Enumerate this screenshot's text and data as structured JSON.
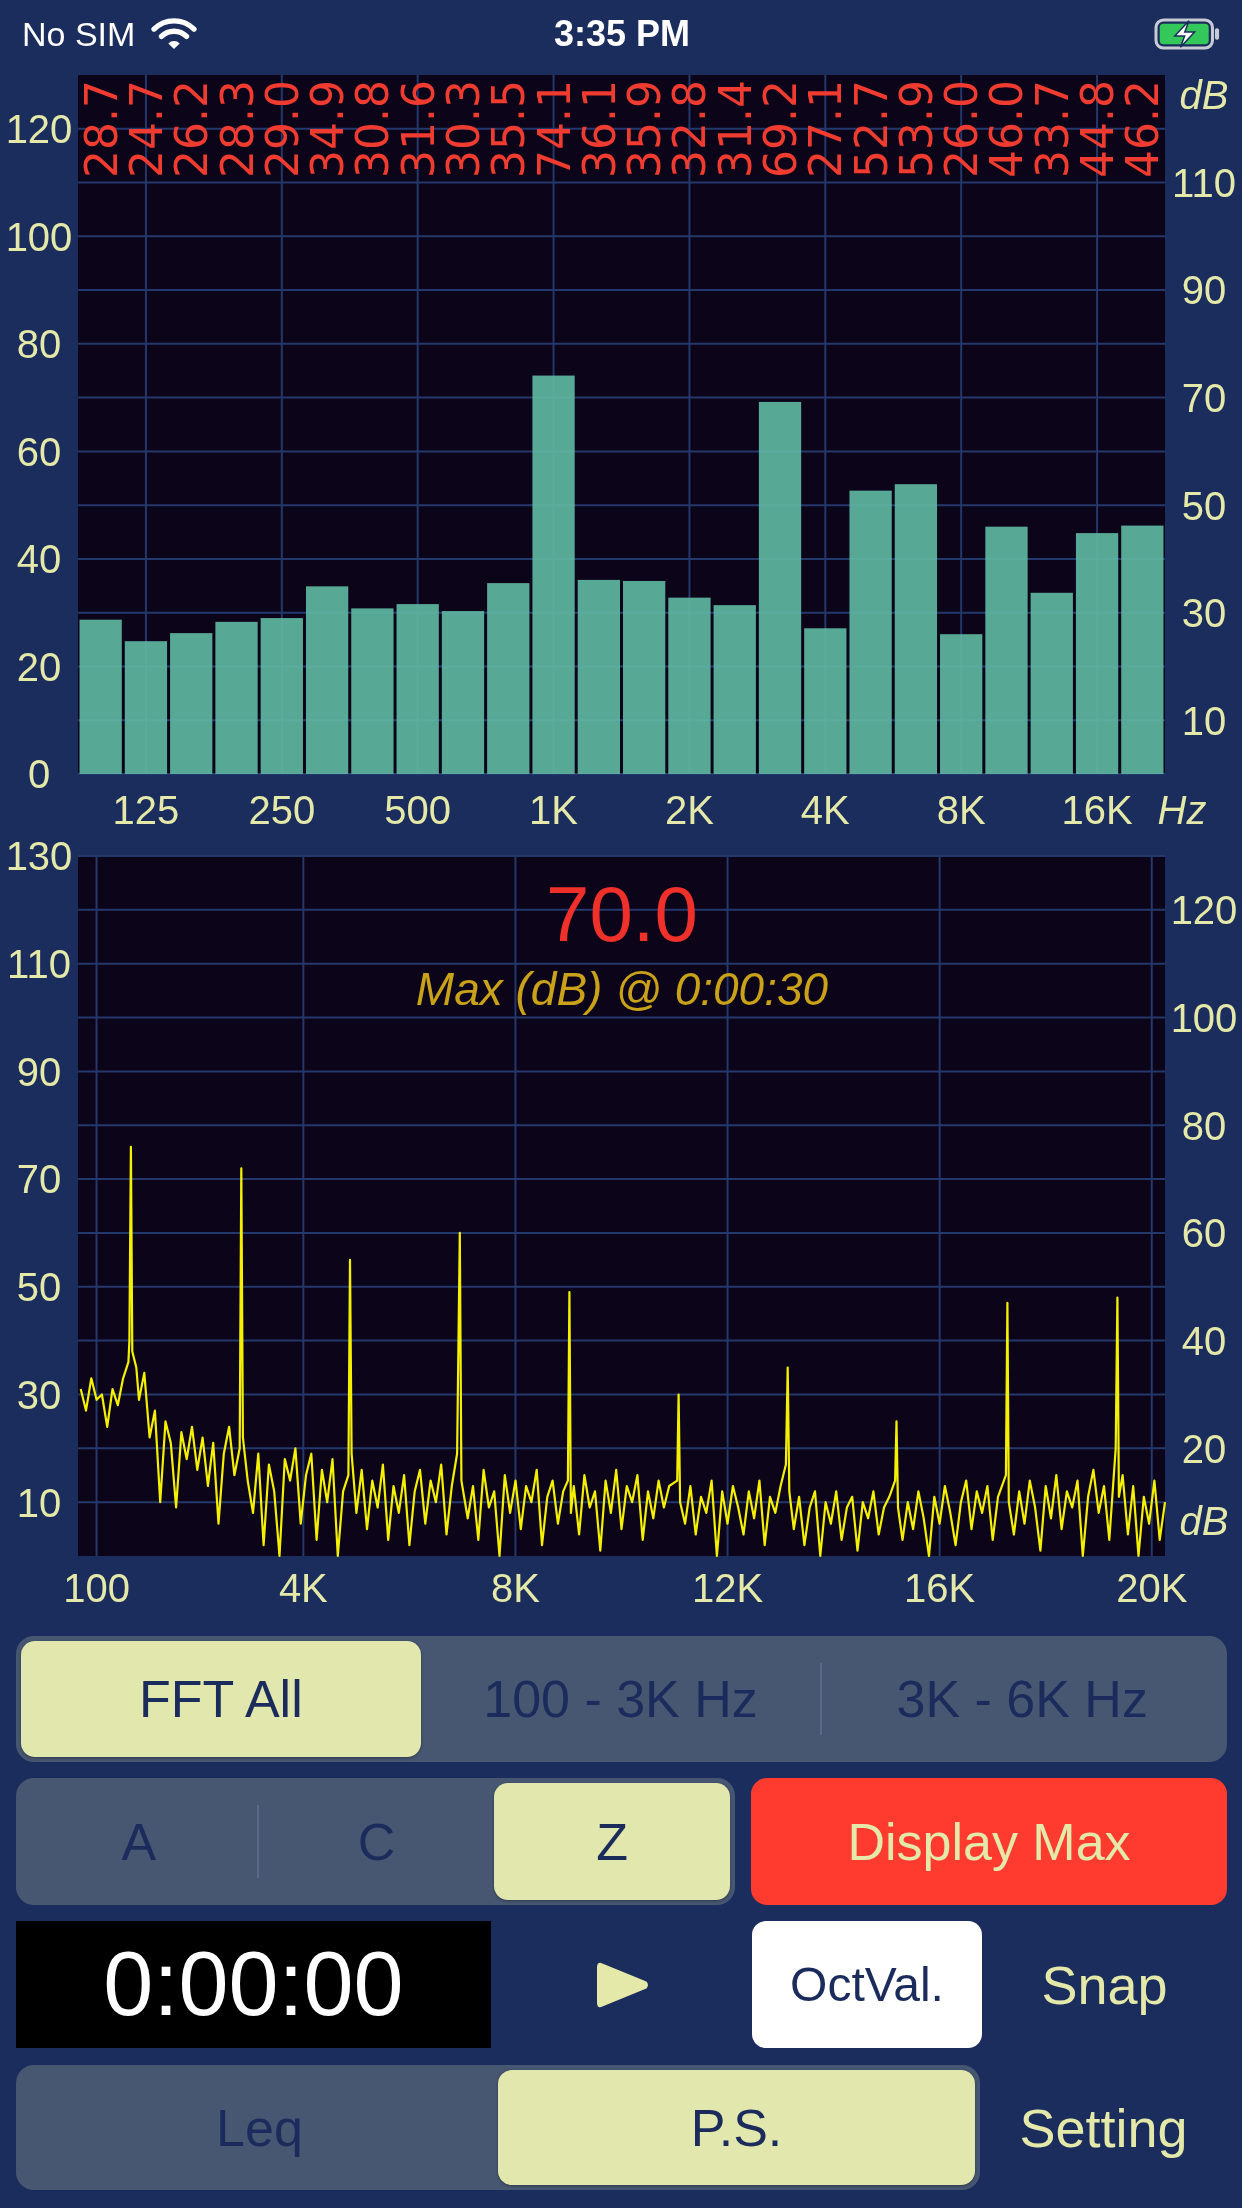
{
  "status_bar": {
    "carrier": "No SIM",
    "time": "3:35 PM"
  },
  "octave_chart": {
    "band_readings": [
      "28.7",
      "24.7",
      "26.2",
      "28.3",
      "29.0",
      "34.9",
      "30.8",
      "31.6",
      "30.3",
      "35.5",
      "74.1",
      "36.1",
      "35.9",
      "32.8",
      "31.4",
      "69.2",
      "27.1",
      "52.7",
      "53.9",
      "26.0",
      "46.0",
      "33.7",
      "44.8",
      "46.2"
    ],
    "right_axis_labels": [
      "110",
      "90",
      "70",
      "50",
      "30",
      "10"
    ],
    "chart_data": {
      "type": "bar",
      "xlabel": "Hz",
      "ylabel": "dB",
      "categories": [
        null,
        "125",
        null,
        null,
        "250",
        null,
        null,
        "500",
        null,
        null,
        "1K",
        null,
        null,
        "2K",
        null,
        null,
        "4K",
        null,
        null,
        "8K",
        null,
        null,
        "16K",
        null
      ],
      "values": [
        28.7,
        24.7,
        26.2,
        28.3,
        29.0,
        34.9,
        30.8,
        31.6,
        30.3,
        35.5,
        74.1,
        36.1,
        35.9,
        32.8,
        31.4,
        69.2,
        27.1,
        52.7,
        53.9,
        26.0,
        46.0,
        33.7,
        44.8,
        46.2
      ],
      "ylim": [
        0,
        130
      ],
      "yticks": [
        0,
        20,
        40,
        60,
        80,
        100,
        120
      ],
      "grid": true
    }
  },
  "spectrum_chart": {
    "max_value": "70.0",
    "max_caption": "Max (dB) @ 0:00:30",
    "right_axis_labels": [
      "120",
      "100",
      "80",
      "60",
      "40",
      "20"
    ],
    "chart_data": {
      "type": "line",
      "ylabel": "dB",
      "x": [
        -200,
        -100,
        0,
        100,
        200,
        300,
        400,
        500,
        600,
        700,
        720,
        747,
        775,
        850,
        900,
        1000,
        1100,
        1200,
        1300,
        1400,
        1500,
        1600,
        1700,
        1800,
        1900,
        2000,
        2100,
        2200,
        2300,
        2400,
        2500,
        2600,
        2700,
        2800,
        2830,
        2860,
        2950,
        3050,
        3150,
        3250,
        3350,
        3450,
        3550,
        3650,
        3750,
        3850,
        3950,
        4050,
        4150,
        4250,
        4350,
        4450,
        4550,
        4650,
        4750,
        4850,
        4880,
        4910,
        5000,
        5100,
        5200,
        5300,
        5400,
        5500,
        5600,
        5700,
        5800,
        5900,
        6000,
        6100,
        6200,
        6300,
        6400,
        6500,
        6600,
        6700,
        6800,
        6900,
        6950,
        6980,
        7100,
        7200,
        7300,
        7400,
        7500,
        7600,
        7700,
        7800,
        7900,
        8000,
        8100,
        8200,
        8300,
        8400,
        8500,
        8600,
        8700,
        8800,
        8900,
        8990,
        9017,
        9045,
        9100,
        9200,
        9300,
        9400,
        9500,
        9600,
        9700,
        9800,
        9900,
        10000,
        10100,
        10200,
        10300,
        10400,
        10500,
        10600,
        10700,
        10800,
        10900,
        11050,
        11077,
        11105,
        11200,
        11300,
        11400,
        11500,
        11600,
        11700,
        11800,
        11900,
        12000,
        12100,
        12200,
        12300,
        12400,
        12500,
        12600,
        12700,
        12800,
        12900,
        13000,
        13100,
        13134,
        13165,
        13250,
        13350,
        13450,
        13550,
        13650,
        13750,
        13850,
        13950,
        14050,
        14150,
        14250,
        14350,
        14450,
        14550,
        14650,
        14750,
        14850,
        14950,
        15050,
        15160,
        15187,
        15215,
        15300,
        15400,
        15500,
        15600,
        15700,
        15800,
        15900,
        16000,
        16100,
        16200,
        16300,
        16400,
        16500,
        16600,
        16700,
        16800,
        16900,
        17000,
        17100,
        17250,
        17278,
        17305,
        17400,
        17500,
        17600,
        17700,
        17800,
        17900,
        18000,
        18100,
        18200,
        18300,
        18400,
        18500,
        18600,
        18700,
        18800,
        18900,
        19000,
        19100,
        19200,
        19320,
        19352,
        19380,
        19450,
        19550,
        19650,
        19750,
        19850,
        19950,
        20050,
        20150,
        20250
      ],
      "values": [
        31,
        27,
        33,
        29,
        30,
        24,
        31,
        28,
        33,
        36,
        40,
        76,
        38,
        35,
        29,
        34,
        22,
        27,
        10,
        25,
        21,
        9,
        23,
        18,
        24,
        16,
        22,
        13,
        21,
        6,
        19,
        24,
        15,
        20,
        72,
        22,
        14,
        8,
        19,
        2,
        17,
        12,
        0,
        18,
        14,
        20,
        6,
        15,
        19,
        3,
        16,
        10,
        18,
        0,
        12,
        15,
        55,
        19,
        8,
        16,
        5,
        14,
        9,
        17,
        3,
        13,
        8,
        15,
        2,
        12,
        16,
        6,
        14,
        10,
        17,
        4,
        13,
        19,
        60,
        14,
        7,
        13,
        3,
        16,
        9,
        12,
        0,
        15,
        8,
        14,
        5,
        13,
        10,
        16,
        2,
        11,
        14,
        6,
        12,
        14,
        49,
        8,
        13,
        4,
        15,
        9,
        12,
        1,
        14,
        8,
        16,
        5,
        13,
        10,
        15,
        3,
        12,
        7,
        14,
        9,
        13,
        14,
        30,
        10,
        6,
        13,
        4,
        11,
        8,
        14,
        0,
        12,
        6,
        13,
        9,
        4,
        12,
        7,
        14,
        2,
        11,
        8,
        13,
        17,
        35,
        12,
        5,
        11,
        2,
        9,
        12,
        0,
        10,
        6,
        12,
        3,
        9,
        11,
        1,
        10,
        7,
        12,
        4,
        9,
        11,
        14,
        25,
        9,
        3,
        10,
        5,
        12,
        7,
        0,
        11,
        6,
        13,
        8,
        2,
        10,
        14,
        5,
        12,
        8,
        13,
        3,
        11,
        15,
        47,
        10,
        4,
        12,
        6,
        14,
        9,
        1,
        13,
        7,
        15,
        5,
        12,
        9,
        14,
        0,
        11,
        16,
        8,
        13,
        3,
        20,
        48,
        11,
        15,
        4,
        13,
        0,
        11,
        6,
        14,
        3,
        10
      ],
      "xlim": [
        -250,
        20250
      ],
      "ylim": [
        0,
        130
      ],
      "xticks": [
        {
          "value": 100,
          "label": "100"
        },
        {
          "value": 4000,
          "label": "4K"
        },
        {
          "value": 8000,
          "label": "8K"
        },
        {
          "value": 12000,
          "label": "12K"
        },
        {
          "value": 16000,
          "label": "16K"
        },
        {
          "value": 20000,
          "label": "20K"
        }
      ],
      "yticks": [
        10,
        30,
        50,
        70,
        90,
        110,
        130
      ],
      "grid": true
    }
  },
  "fft_range_tabs": [
    {
      "label": "FFT All",
      "selected": true
    },
    {
      "label": "100 - 3K Hz",
      "selected": false
    },
    {
      "label": "3K - 6K Hz",
      "selected": false
    }
  ],
  "weighting_tabs": [
    {
      "label": "A",
      "selected": false
    },
    {
      "label": "C",
      "selected": false
    },
    {
      "label": "Z",
      "selected": true
    }
  ],
  "display_max_button": {
    "label": "Display Max"
  },
  "timer": {
    "value": "0:00:00"
  },
  "octval_button": {
    "label": "OctVal.",
    "on": true
  },
  "snap_button": {
    "label": "Snap"
  },
  "mode_tabs": [
    {
      "label": "Leq",
      "selected": false
    },
    {
      "label": "P.S.",
      "selected": true
    }
  ],
  "setting_button": {
    "label": "Setting"
  }
}
